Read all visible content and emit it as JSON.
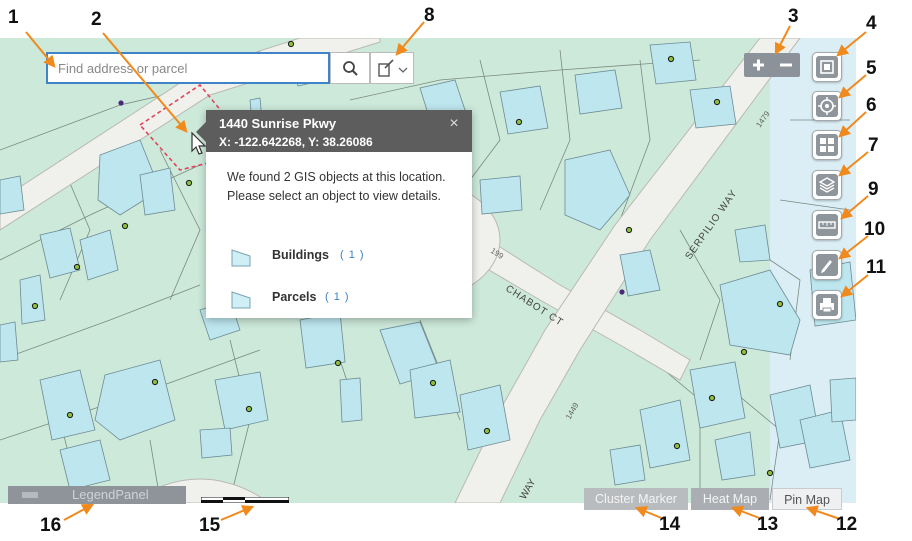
{
  "search": {
    "placeholder": "Find address or parcel"
  },
  "popup": {
    "title": "1440 Sunrise Pkwy",
    "coords": "X: -122.642268, Y: 38.26086",
    "close": "×",
    "message": "We found 2 GIS objects at this location. Please select an object to view details.",
    "items": [
      {
        "name": "Buildings",
        "count": "( 1 )"
      },
      {
        "name": "Parcels",
        "count": "( 1 )"
      }
    ]
  },
  "map_labels": {
    "chabot": "CHABOT CT",
    "serpilio": "SERPILIO WAY",
    "num_199": "199",
    "num_1479": "1479",
    "num_1449": "1449",
    "way_partial": "WAY"
  },
  "tabs": {
    "cluster": "Cluster Marker",
    "heat": "Heat Map",
    "pin": "Pin Map",
    "legend": "LegendPanel"
  },
  "callouts": [
    "1",
    "2",
    "3",
    "4",
    "5",
    "6",
    "7",
    "8",
    "9",
    "10",
    "11",
    "12",
    "13",
    "14",
    "15",
    "16"
  ],
  "icons": {
    "search": "search-icon",
    "draw": "draw-tool-icon",
    "zoom_in": "zoom-in-icon",
    "zoom_out": "zoom-out-icon",
    "full_extent": "full-extent-icon",
    "locate": "locate-icon",
    "basemap": "basemap-icon",
    "layers": "layers-icon",
    "measure": "measure-icon",
    "markup": "markup-pencil-icon",
    "print": "print-icon"
  },
  "colors": {
    "map_background": "#cde9da",
    "building_fill": "#bde6ee",
    "road": "#f0f0ec",
    "accent_blue": "#3f83c9",
    "popup_header": "#5d5d5d",
    "arrow_orange": "#f08a1d",
    "selection_red": "#e0455a",
    "tool_gray": "#8e959b"
  }
}
